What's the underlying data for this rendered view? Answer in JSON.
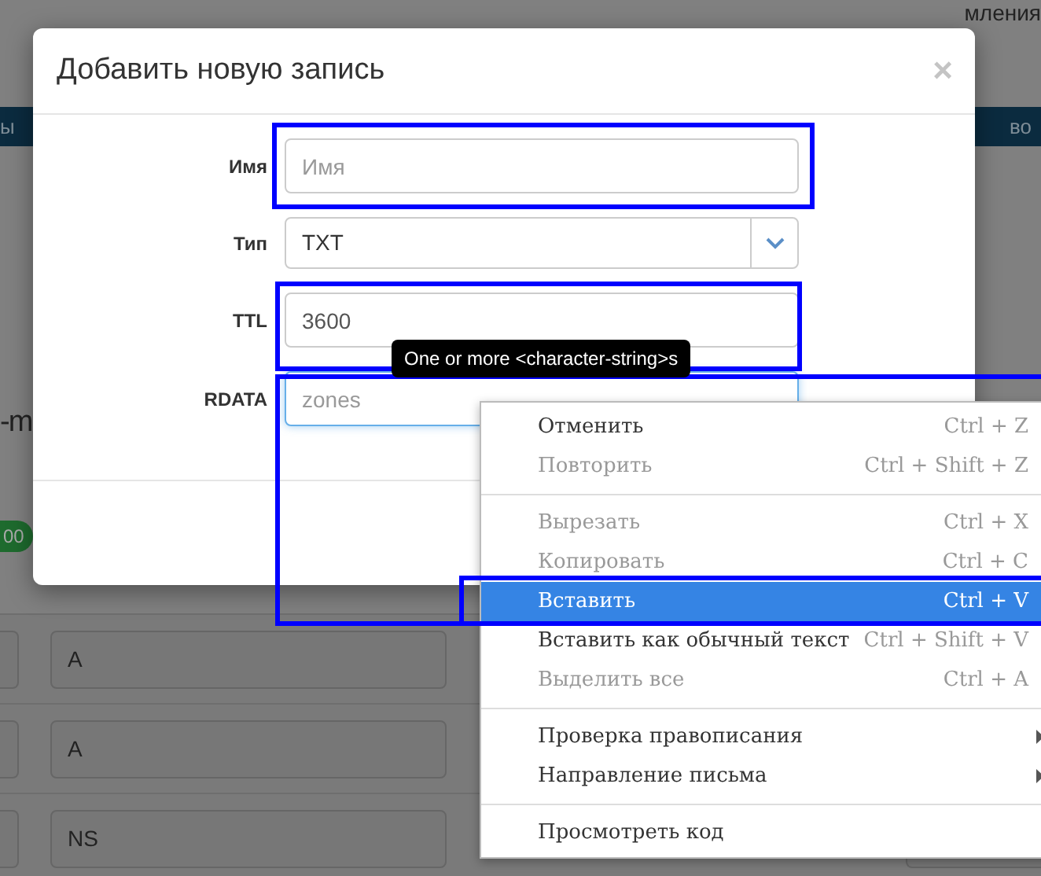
{
  "background": {
    "header_text": "мления",
    "nav_left": "ы",
    "nav_right": "во",
    "heading": "-m",
    "badge": "00",
    "rows": [
      {
        "type": "A"
      },
      {
        "type": "A"
      },
      {
        "type": "NS"
      }
    ]
  },
  "modal": {
    "title": "Добавить новую запись",
    "close": "×",
    "fields": [
      {
        "label": "Имя",
        "kind": "text",
        "placeholder": "Имя"
      },
      {
        "label": "Тип",
        "kind": "select",
        "value": "TXT"
      },
      {
        "label": "TTL",
        "kind": "text",
        "value": "3600"
      },
      {
        "label": "RDATA",
        "kind": "text",
        "placeholder": "zones",
        "focused": true
      }
    ],
    "tooltip": "One or more <character-string>s"
  },
  "context_menu": {
    "groups": [
      [
        {
          "label": "Отменить",
          "shortcut": "Ctrl + Z",
          "disabled": false,
          "selected": false
        },
        {
          "label": "Повторить",
          "shortcut": "Ctrl + Shift + Z",
          "disabled": true,
          "selected": false
        }
      ],
      [
        {
          "label": "Вырезать",
          "shortcut": "Ctrl + X",
          "disabled": true,
          "selected": false
        },
        {
          "label": "Копировать",
          "shortcut": "Ctrl + C",
          "disabled": true,
          "selected": false
        },
        {
          "label": "Вставить",
          "shortcut": "Ctrl + V",
          "disabled": false,
          "selected": true
        },
        {
          "label": "Вставить как обычный текст",
          "shortcut": "Ctrl + Shift + V",
          "disabled": false,
          "selected": false
        },
        {
          "label": "Выделить все",
          "shortcut": "Ctrl + A",
          "disabled": true,
          "selected": false
        }
      ],
      [
        {
          "label": "Проверка правописания",
          "disabled": false,
          "selected": false,
          "submenu": true
        },
        {
          "label": "Направление письма",
          "disabled": false,
          "selected": false,
          "submenu": true
        }
      ],
      [
        {
          "label": "Просмотреть код",
          "disabled": false,
          "selected": false
        }
      ]
    ]
  }
}
